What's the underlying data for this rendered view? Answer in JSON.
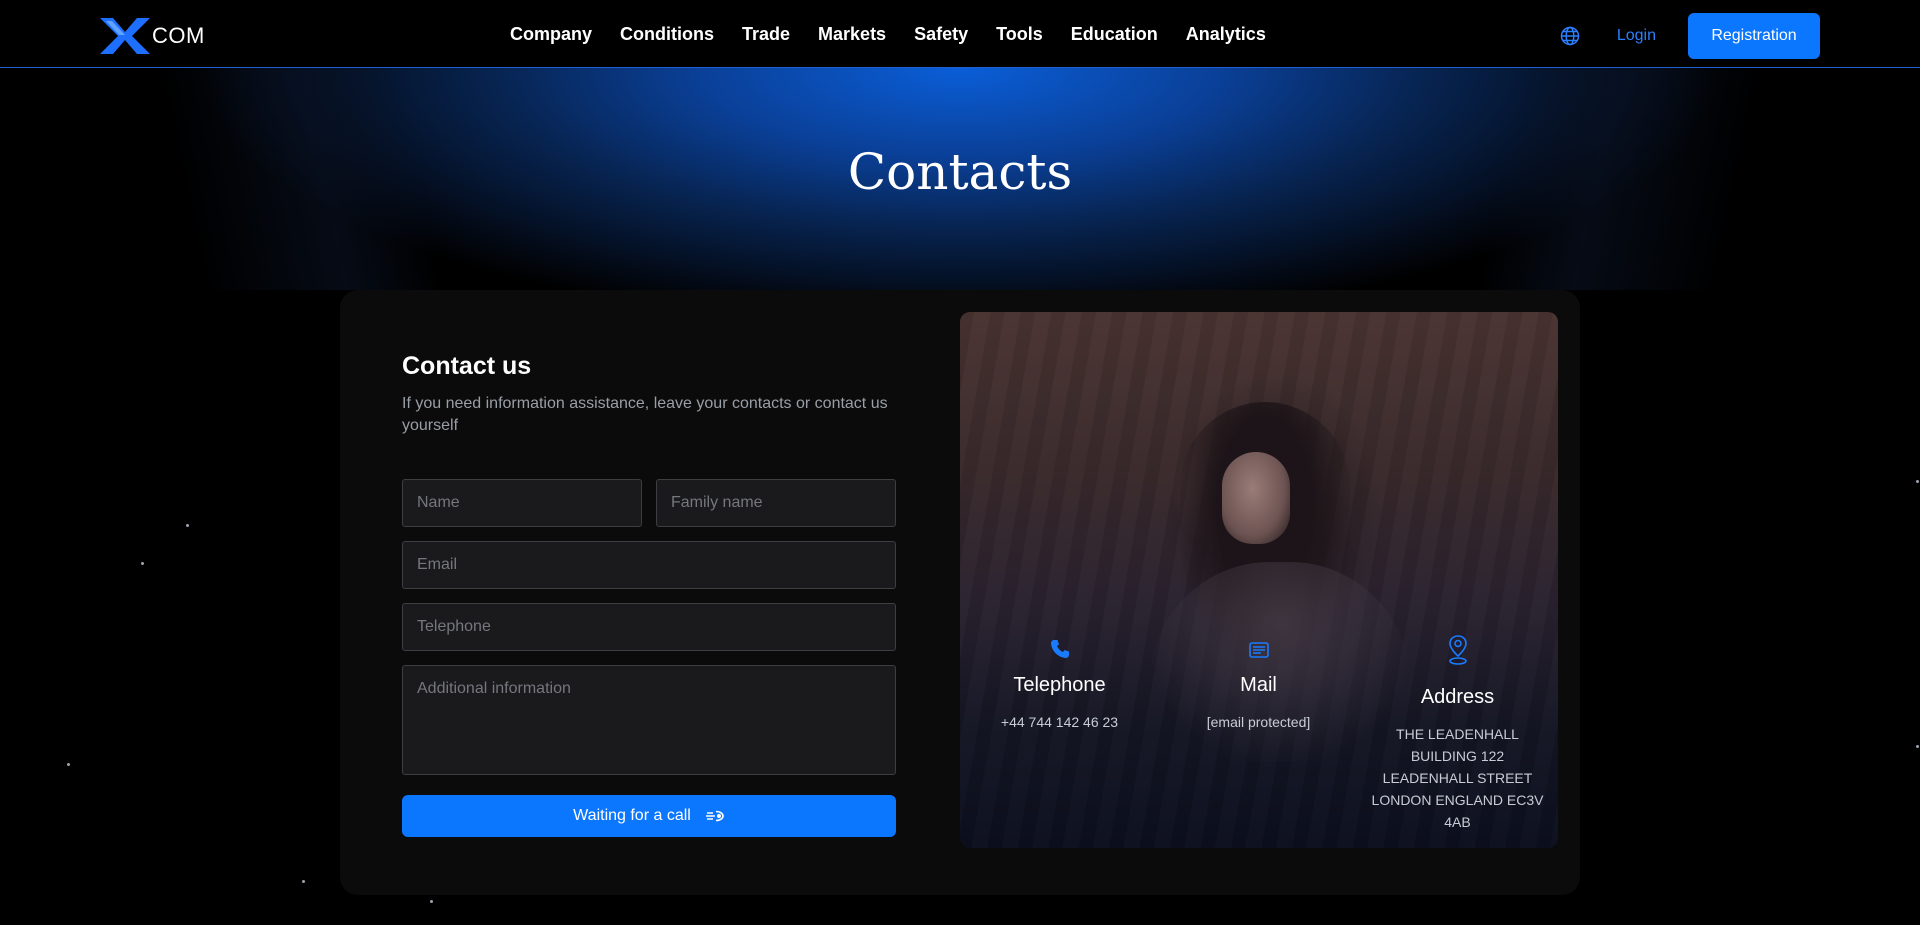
{
  "brand": {
    "logo_text": "COM",
    "accent": "#0b77ff"
  },
  "nav": {
    "items": [
      "Company",
      "Conditions",
      "Trade",
      "Markets",
      "Safety",
      "Tools",
      "Education",
      "Analytics"
    ]
  },
  "header": {
    "lang_icon": "globe-icon",
    "login_label": "Login",
    "registration_label": "Registration"
  },
  "hero": {
    "title": "Contacts"
  },
  "contact_form": {
    "title": "Contact us",
    "description": "If you need information assistance, leave your contacts or contact us yourself",
    "name_placeholder": "Name",
    "family_placeholder": "Family name",
    "email_placeholder": "Email",
    "telephone_placeholder": "Telephone",
    "additional_placeholder": "Additional information",
    "submit_label": "Waiting for a call",
    "submit_icon": "phone-wave-icon"
  },
  "info": {
    "telephone": {
      "label": "Telephone",
      "value": "+44 744 142 46 23",
      "icon": "phone-icon"
    },
    "mail": {
      "label": "Mail",
      "value": "[email protected]",
      "icon": "mail-icon"
    },
    "address": {
      "label": "Address",
      "value": "THE LEADENHALL BUILDING 122 LEADENHALL STREET LONDON ENGLAND EC3V 4AB",
      "icon": "location-pin-icon"
    }
  }
}
